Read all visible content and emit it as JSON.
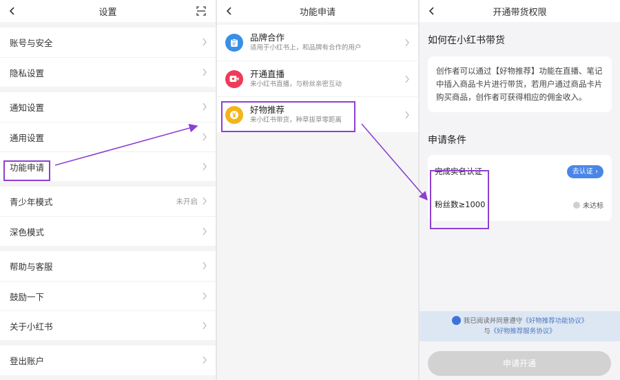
{
  "settings": {
    "title": "设置",
    "groups": [
      [
        "账号与安全",
        "隐私设置"
      ],
      [
        "通知设置",
        "通用设置",
        "功能申请"
      ],
      [
        "青少年模式",
        "深色模式"
      ],
      [
        "帮助与客服",
        "鼓励一下",
        "关于小红书"
      ],
      [
        "登出账户"
      ]
    ],
    "teen_mode_state": "未开启"
  },
  "features": {
    "title": "功能申请",
    "items": [
      {
        "title": "品牌合作",
        "desc": "适用于小红书上，和品牌有合作的用户",
        "icon": "brand-icon",
        "color": "#3a8ee6"
      },
      {
        "title": "开通直播",
        "desc": "来小红书直播，与粉丝亲密互动",
        "icon": "live-icon",
        "color": "#ef3b58"
      },
      {
        "title": "好物推荐",
        "desc": "来小红书带货，种草拔草零距离",
        "icon": "yen-icon",
        "color": "#f4b41a"
      }
    ]
  },
  "sell": {
    "title": "开通带货权限",
    "how_title": "如何在小红书带货",
    "how_desc": "创作者可以通过【好物推荐】功能在直播、笔记中插入商品卡片进行带货，若用户通过商品卡片购买商品，创作者可获得相应的佣金收入。",
    "cond_title": "申请条件",
    "conditions": [
      {
        "label": "完成实名认证",
        "action": "去认证"
      },
      {
        "label": "粉丝数≥1000",
        "status": "未达标"
      }
    ],
    "agree_prefix": "我已阅读并同意遵守",
    "agree_link1": "《好物推荐功能协议》",
    "agree_mid": "与",
    "agree_link2": "《好物推荐服务协议》",
    "submit": "申请开通"
  },
  "colors": {
    "highlight": "#8d3fd1",
    "accent": "#4a86e8",
    "agree_bg": "#dde7f4"
  }
}
